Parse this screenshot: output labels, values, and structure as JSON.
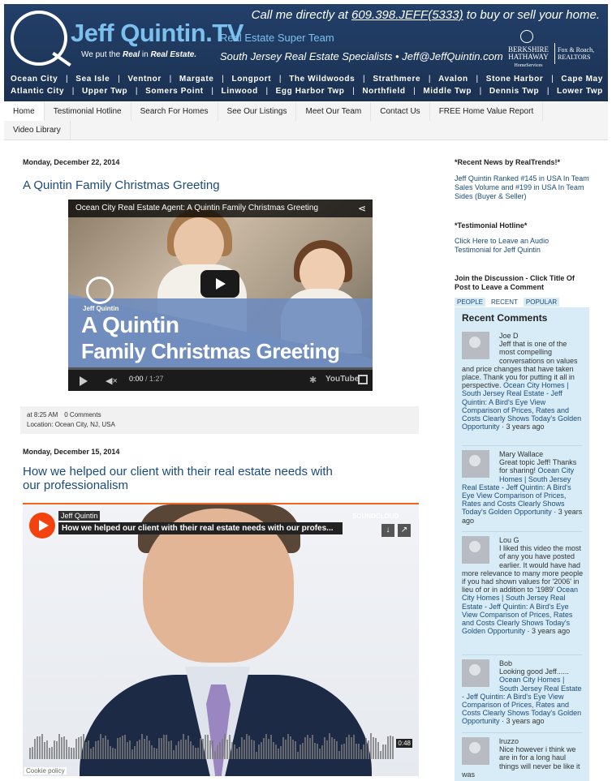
{
  "header": {
    "logo_title": "Jeff Quintin",
    "logo_tv": ".TV",
    "tagline_pre": "We put the ",
    "tagline_bold": "Real",
    "tagline_mid": " in ",
    "tagline_bold2": "Real Estate.",
    "team_name": "Real Estate Super Team",
    "call_pre": "Call me directly at ",
    "phone": "609.398.JEFF(5333)",
    "call_post": " to buy or sell your home.",
    "specialists": "South Jersey Real Estate Specialists  •  Jeff@JeffQuintin.com",
    "brokerage_left": "BERKSHIRE HATHAWAY",
    "brokerage_sub": "HomeServices",
    "brokerage_right": "Fox & Roach, REALTORS",
    "towns_row1": [
      "Ocean City",
      "Sea Isle",
      "Ventnor",
      "Margate",
      "Longport",
      "The Wildwoods",
      "Strathmere",
      "Avalon",
      "Stone Harbor",
      "Cape May"
    ],
    "towns_row2": [
      "Atlantic City",
      "Upper Twp",
      "Somers Point",
      "Linwood",
      "Egg Harbor Twp",
      "Northfield",
      "Middle Twp",
      "Dennis Twp",
      "Lower Twp"
    ]
  },
  "nav": {
    "row1": [
      "Home",
      "Testimonial Hotline",
      "Search For Homes",
      "See Our Listings",
      "Meet Our Team",
      "Contact Us",
      "FREE Home Value Report"
    ],
    "row2": [
      "Video Library"
    ]
  },
  "post1": {
    "date": "Monday, December 22, 2014",
    "title": "A Quintin Family Christmas Greeting",
    "video_title": "Ocean City Real Estate Agent: A Quintin Family Christmas Greeting",
    "overlay_name": "Jeff Quintin",
    "overlay_line1": "A Quintin",
    "overlay_line2": "Family Christmas Greeting",
    "time_current": "0:00",
    "time_total": " / 1:27",
    "yt_label": "YouTube",
    "footer_time": "at 8:25 AM",
    "footer_comments": "0 Comments",
    "footer_location": "Location: Ocean City, NJ, USA"
  },
  "post2": {
    "date": "Monday, December 15, 2014",
    "title": "How we helped our client with their real estate needs with our professionalism",
    "sc_user": "Jeff Quintin",
    "sc_track": "How we helped our client with their real estate needs with our profes...",
    "sc_logo": "SOUNDCLOUD",
    "sc_duration": "0:48",
    "cookie": "Cookie policy"
  },
  "sidebar": {
    "realtrends_head": "*Recent News by RealTrends!*",
    "realtrends_link": "Jeff Quintin Ranked #145 in USA In Team Sales Volume and #199 in USA In Team Sides (Buyer & Seller)",
    "testimonial_head": "*Testimonial Hotline*",
    "testimonial_link": "Click Here to Leave an Audio Testimonial for Jeff Quintin",
    "discussion_head": "Join the Discussion - Click Title Of Post to Leave a Comment",
    "tabs": [
      "PEOPLE",
      "RECENT",
      "POPULAR"
    ],
    "recent_title": "Recent Comments",
    "comments": [
      {
        "author": "Joe D",
        "text": "Jeff that is one of the most compelling conversations on values and price changes that have taken place. Thank you for putting it all in perspective.",
        "link": "Ocean City Homes | South Jersey Real Estate - Jeff Quintin: A Bird's Eye View Comparison of Prices, Rates and Costs Clearly Shows Today's Golden Opportunity",
        "ago": " · 3 years ago"
      },
      {
        "author": "Mary Wallace",
        "text": "Great topic Jeff! Thanks for sharing!",
        "link": "Ocean City Homes | South Jersey Real Estate - Jeff Quintin: A Bird's Eye View Comparison of Prices, Rates and Costs Clearly Shows Today's Golden Opportunity",
        "ago": " · 3 years ago"
      },
      {
        "author": "Lou G",
        "text": "I liked this video the most of any you have posted earlier. It would have had more relevance to many more people if you had shown values for '2006' in lieu of or in addition to '1989'",
        "link": "Ocean City Homes | South Jersey Real Estate - Jeff Quintin: A Bird's Eye View Comparison of Prices, Rates and Costs Clearly Shows Today's Golden Opportunity",
        "ago": " · 3 years ago"
      },
      {
        "author": "Bob",
        "text": "Looking good Jeff......",
        "link": "Ocean City Homes | South Jersey Real Estate - Jeff Quintin: A Bird's Eye View Comparison of Prices, Rates and Costs Clearly Shows Today's Golden Opportunity",
        "ago": " · 3 years ago"
      },
      {
        "author": "lruzzo",
        "text": "Nice however i think we are in for a long haul things will never be like it was",
        "link": "",
        "ago": ""
      }
    ]
  },
  "colors": {
    "header_bg": "#1d3557",
    "logo_blue": "#7cc0ee",
    "link_blue": "#1b4b7a",
    "comments_bg": "#d7ecf7",
    "accent_orange": "#f26522"
  }
}
